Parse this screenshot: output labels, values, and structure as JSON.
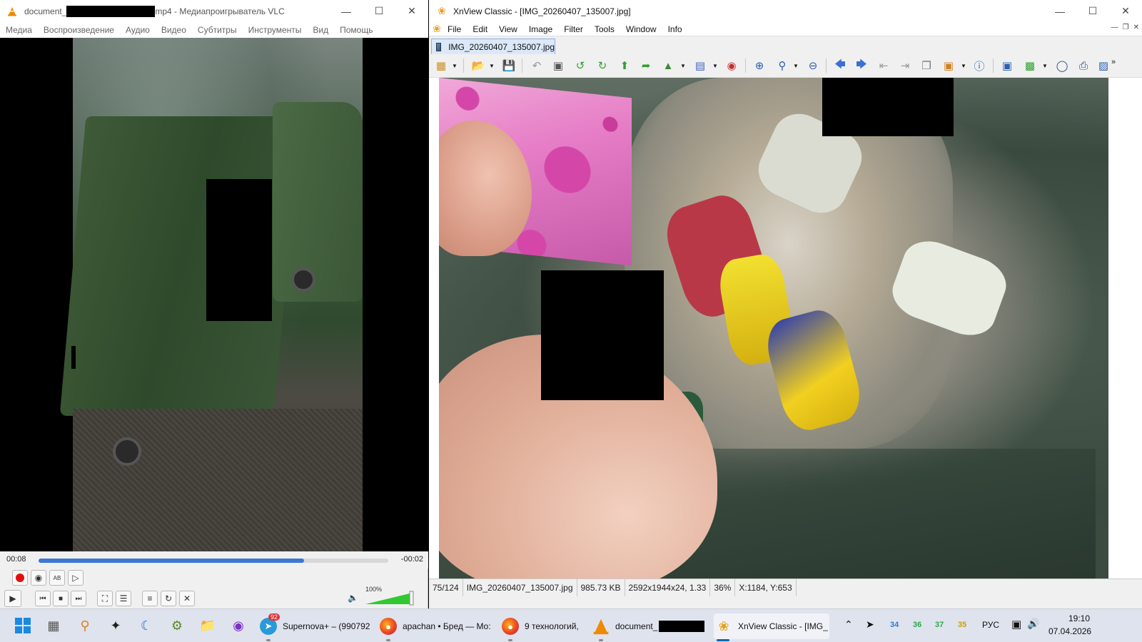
{
  "vlc": {
    "title_prefix": "document_",
    "title_suffix": "mp4 - Медиапроигрыватель VLC",
    "menu": [
      "Медиа",
      "Воспроизведение",
      "Аудио",
      "Видео",
      "Субтитры",
      "Инструменты",
      "Вид",
      "Помощь"
    ],
    "time_elapsed": "00:08",
    "time_remaining": "-00:02",
    "progress_fraction": 0.76,
    "volume_label": "100%",
    "volume_fraction": 1.0
  },
  "xnview": {
    "title": "XnView Classic - [IMG_20260407_135007.jpg]",
    "menu": [
      "File",
      "Edit",
      "View",
      "Image",
      "Filter",
      "Tools",
      "Window",
      "Info"
    ],
    "tab_label": "IMG_20260407_135007.jpg",
    "status": {
      "index": "75/124",
      "filename": "IMG_20260407_135007.jpg",
      "filesize": "985.73 KB",
      "dimensions": "2592x1944x24, 1.33",
      "zoom": "36%",
      "cursor": "X:1184, Y:653"
    }
  },
  "taskbar": {
    "apps": [
      {
        "label": "Supernova+ – (990792",
        "badge": "92"
      },
      {
        "label": "apachan • Бред — Mo:"
      },
      {
        "label": "9 технологий,"
      },
      {
        "label": "document_"
      },
      {
        "label": "XnView Classic - [IMG_"
      }
    ],
    "tray_numbers": [
      "34",
      "36",
      "37",
      "35"
    ],
    "tray_number_colors": [
      "#2a7fd4",
      "#2aa84a",
      "#2aa84a",
      "#c8a000"
    ],
    "language": "РУС",
    "time": "19:10",
    "date": "07.04.2026"
  }
}
